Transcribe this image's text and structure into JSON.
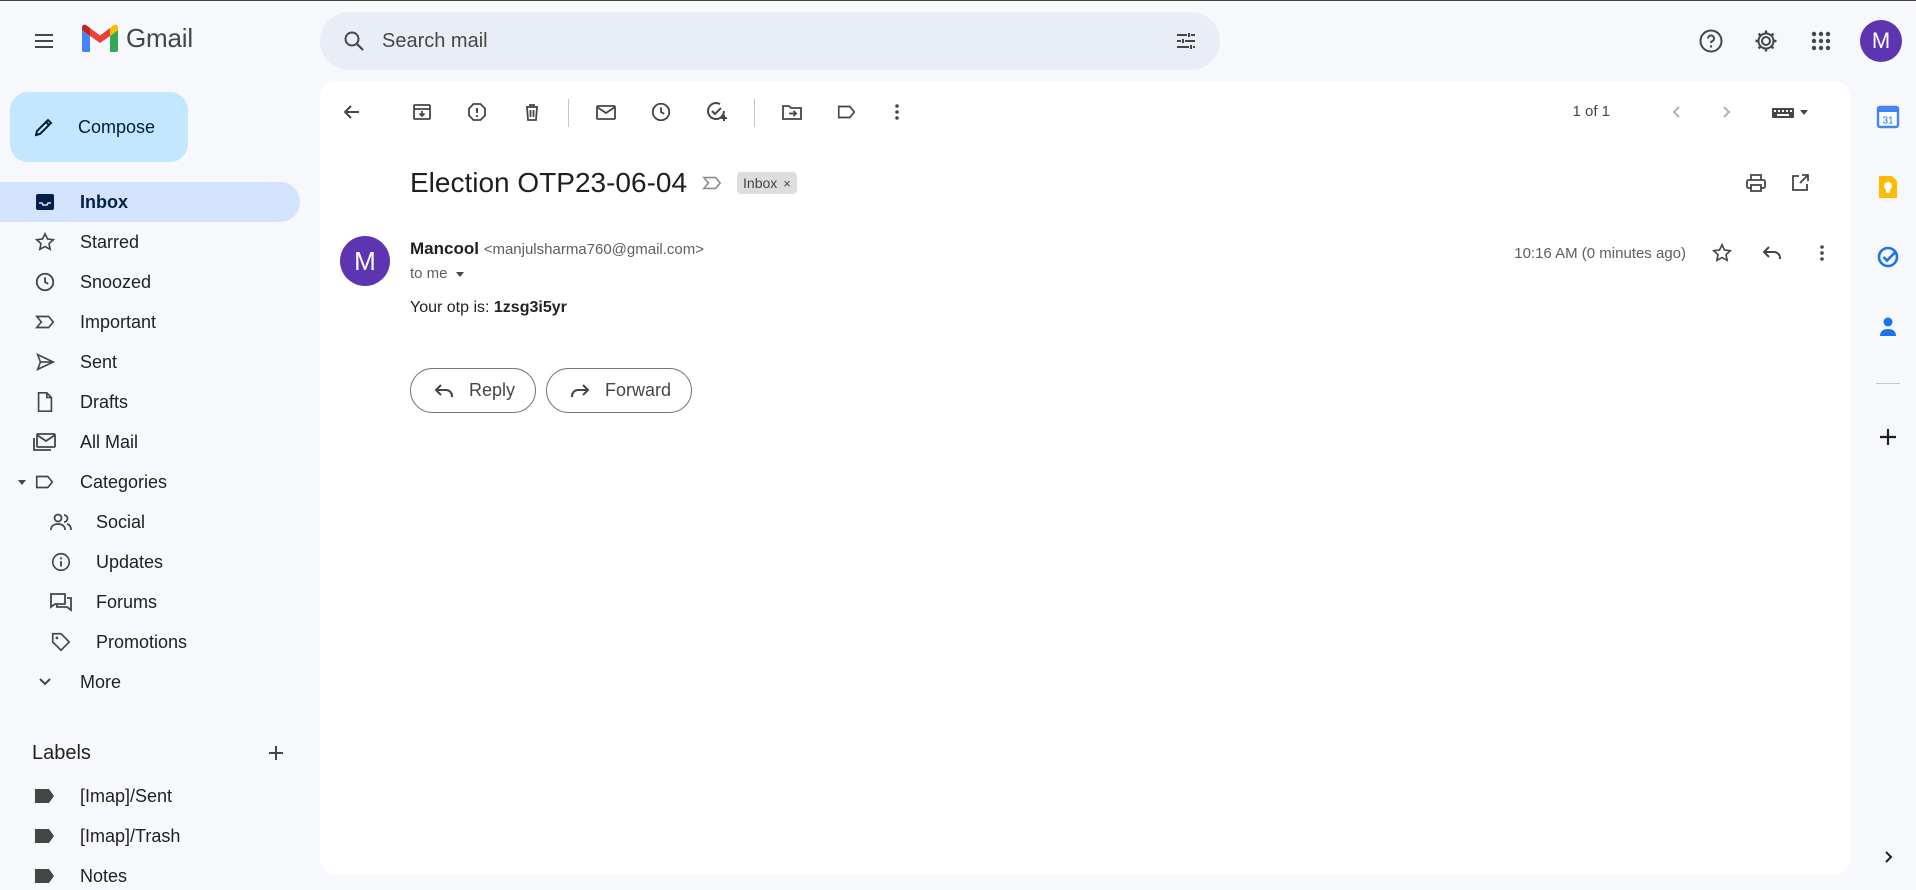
{
  "app": {
    "name": "Gmail",
    "account_initial": "M"
  },
  "search": {
    "placeholder": "Search mail"
  },
  "compose": {
    "label": "Compose"
  },
  "nav": {
    "inbox": "Inbox",
    "starred": "Starred",
    "snoozed": "Snoozed",
    "important": "Important",
    "sent": "Sent",
    "drafts": "Drafts",
    "all_mail": "All Mail",
    "categories": "Categories",
    "social": "Social",
    "updates": "Updates",
    "forums": "Forums",
    "promotions": "Promotions",
    "more": "More"
  },
  "labels": {
    "title": "Labels",
    "items": [
      "[Imap]/Sent",
      "[Imap]/Trash",
      "Notes"
    ]
  },
  "toolbar": {
    "pager": "1 of 1"
  },
  "email": {
    "subject": "Election OTP23-06-04",
    "chip": "Inbox",
    "chip_close": "×",
    "sender_initial": "M",
    "sender_name": "Mancool",
    "sender_email": "<manjulsharma760@gmail.com>",
    "to": "to me",
    "time": "10:16 AM (0 minutes ago)",
    "body_prefix": "Your otp is: ",
    "otp": "1zsg3i5yr"
  },
  "actions": {
    "reply": "Reply",
    "forward": "Forward"
  },
  "calendar_day": "31",
  "colors": {
    "accent": "#c2e7ff",
    "active": "#d3e3fd",
    "avatar": "#5e35b1",
    "background": "#f6f8fc"
  }
}
